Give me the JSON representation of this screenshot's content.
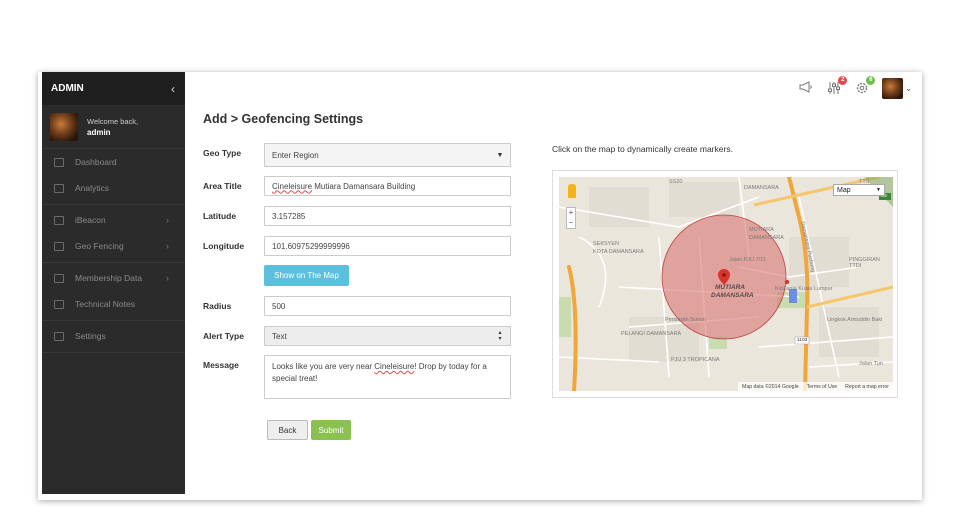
{
  "sidebar": {
    "brand": "ADMIN",
    "welcome": "Welcome back,",
    "username": "admin",
    "items": [
      {
        "label": "Dashboard"
      },
      {
        "label": "Analytics"
      },
      {
        "label": "iBeacon"
      },
      {
        "label": "Geo Fencing"
      },
      {
        "label": "Membership Data"
      },
      {
        "label": "Technical Notes"
      },
      {
        "label": "Settings"
      }
    ]
  },
  "topbar": {
    "notifications_badge": "2",
    "settings_badge": "6"
  },
  "page": {
    "title": "Add > Geofencing Settings"
  },
  "form": {
    "geo_type_label": "Geo Type",
    "geo_type_value": "Enter Region",
    "area_title_label": "Area Title",
    "area_title_word1": "Cineleisure",
    "area_title_rest": " Mutiara Damansara Building",
    "latitude_label": "Latitude",
    "latitude_value": "3.157285",
    "longitude_label": "Longitude",
    "longitude_value": "101.60975299999996",
    "show_map_button": "Show on The Map",
    "radius_label": "Radius",
    "radius_value": "500",
    "alert_type_label": "Alert Type",
    "alert_type_value": "Text",
    "message_label": "Message",
    "message_part1": "Looks like you are very near ",
    "message_word": "Cineleisure",
    "message_part2": "! Drop by today for a special treat!",
    "back_button": "Back",
    "submit_button": "Submit"
  },
  "map": {
    "hint": "Click on the map to dynamically create markers.",
    "type_selector": "Map",
    "zoom_in": "+",
    "zoom_out": "−",
    "center_label_1": "MUTIARA",
    "center_label_2": "DAMANSARA",
    "labels": {
      "ss20": "SS20",
      "damansara_top": "DAMANSARA",
      "tts": "TTS",
      "seksyen": "SEKSYEN",
      "kota_damansara": "KOTA DAMANSARA",
      "mutiara_top": "MUTIARA",
      "damansara_mid": "DAMANSARA",
      "jalan_pju_711": "Jalan PJU 7/11",
      "kidzania": "KidZania Kuala Lumpur",
      "pinggiran": "PINGGIRAN TTDI",
      "persiaran_surian": "Persiaran Surian",
      "pelangi": "PELANGI DAMANSARA",
      "pju3": "PJU 3 TROPICANA",
      "lingkok": "Lingkok Amiuddin Baki",
      "jalan_tun": "Jalan Tun",
      "road_1103": "1103",
      "road_e2": "E2",
      "damansara_puchong": "Damansara Puchong"
    },
    "attribution": [
      "Map data ©2014 Google",
      "Terms of Use",
      "Report a map error"
    ]
  }
}
